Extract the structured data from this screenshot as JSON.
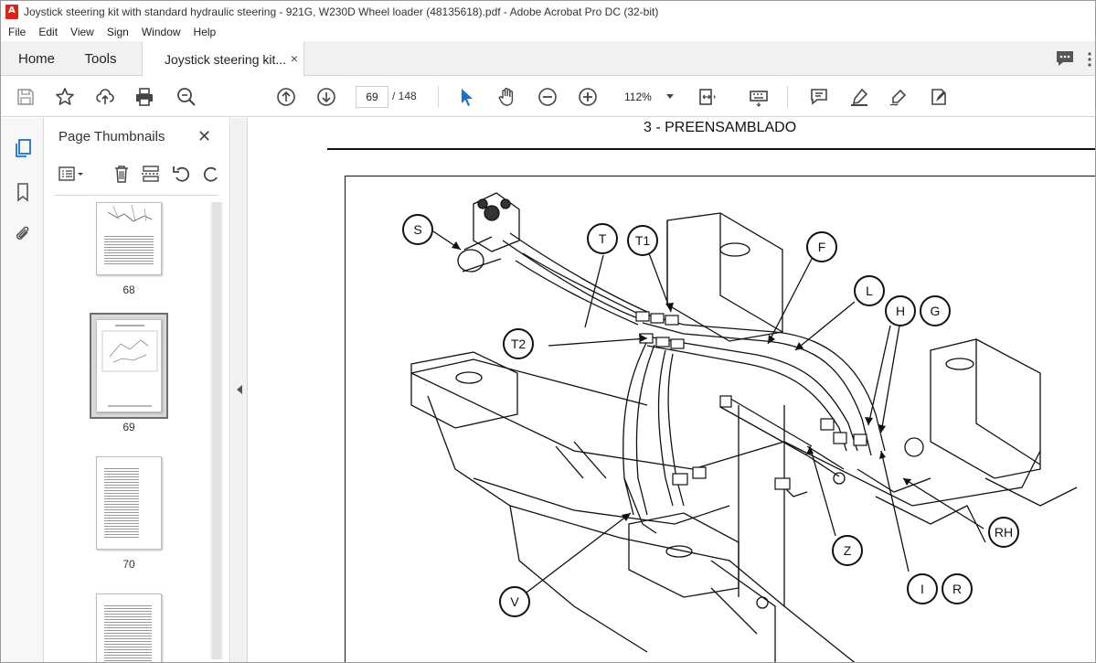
{
  "window": {
    "title": "Joystick steering kit with standard hydraulic steering - 921G, W230D Wheel loader (48135618).pdf - Adobe Acrobat Pro DC (32-bit)"
  },
  "menu": [
    "File",
    "Edit",
    "View",
    "Sign",
    "Window",
    "Help"
  ],
  "tabs": {
    "home": "Home",
    "tools": "Tools",
    "document": "Joystick steering kit...",
    "close_glyph": "×"
  },
  "toolbar": {
    "current_page": "69",
    "total_pages": "/ 148",
    "zoom": "112%"
  },
  "thumbnails": {
    "title": "Page Thumbnails",
    "close_glyph": "✕",
    "pages": [
      {
        "label": "68",
        "selected": false
      },
      {
        "label": "69",
        "selected": true
      },
      {
        "label": "70",
        "selected": false
      },
      {
        "label": "",
        "selected": false
      }
    ]
  },
  "document": {
    "section_title": "3 - PREENSAMBLADO",
    "callouts": [
      "S",
      "T",
      "T1",
      "F",
      "L",
      "H",
      "G",
      "T2",
      "RH",
      "Z",
      "I",
      "R",
      "V"
    ]
  },
  "icons": {
    "save": "save-icon",
    "bookmark": "star-icon",
    "share": "upload-icon",
    "print": "print-icon",
    "find": "search-zoom-icon",
    "prev": "arrow-up-circle-icon",
    "next": "arrow-down-circle-icon",
    "select": "cursor-arrow-icon",
    "hand": "hand-icon",
    "zoom_out": "minus-circle-icon",
    "zoom_in": "plus-circle-icon",
    "accent": "#1a73c8"
  }
}
